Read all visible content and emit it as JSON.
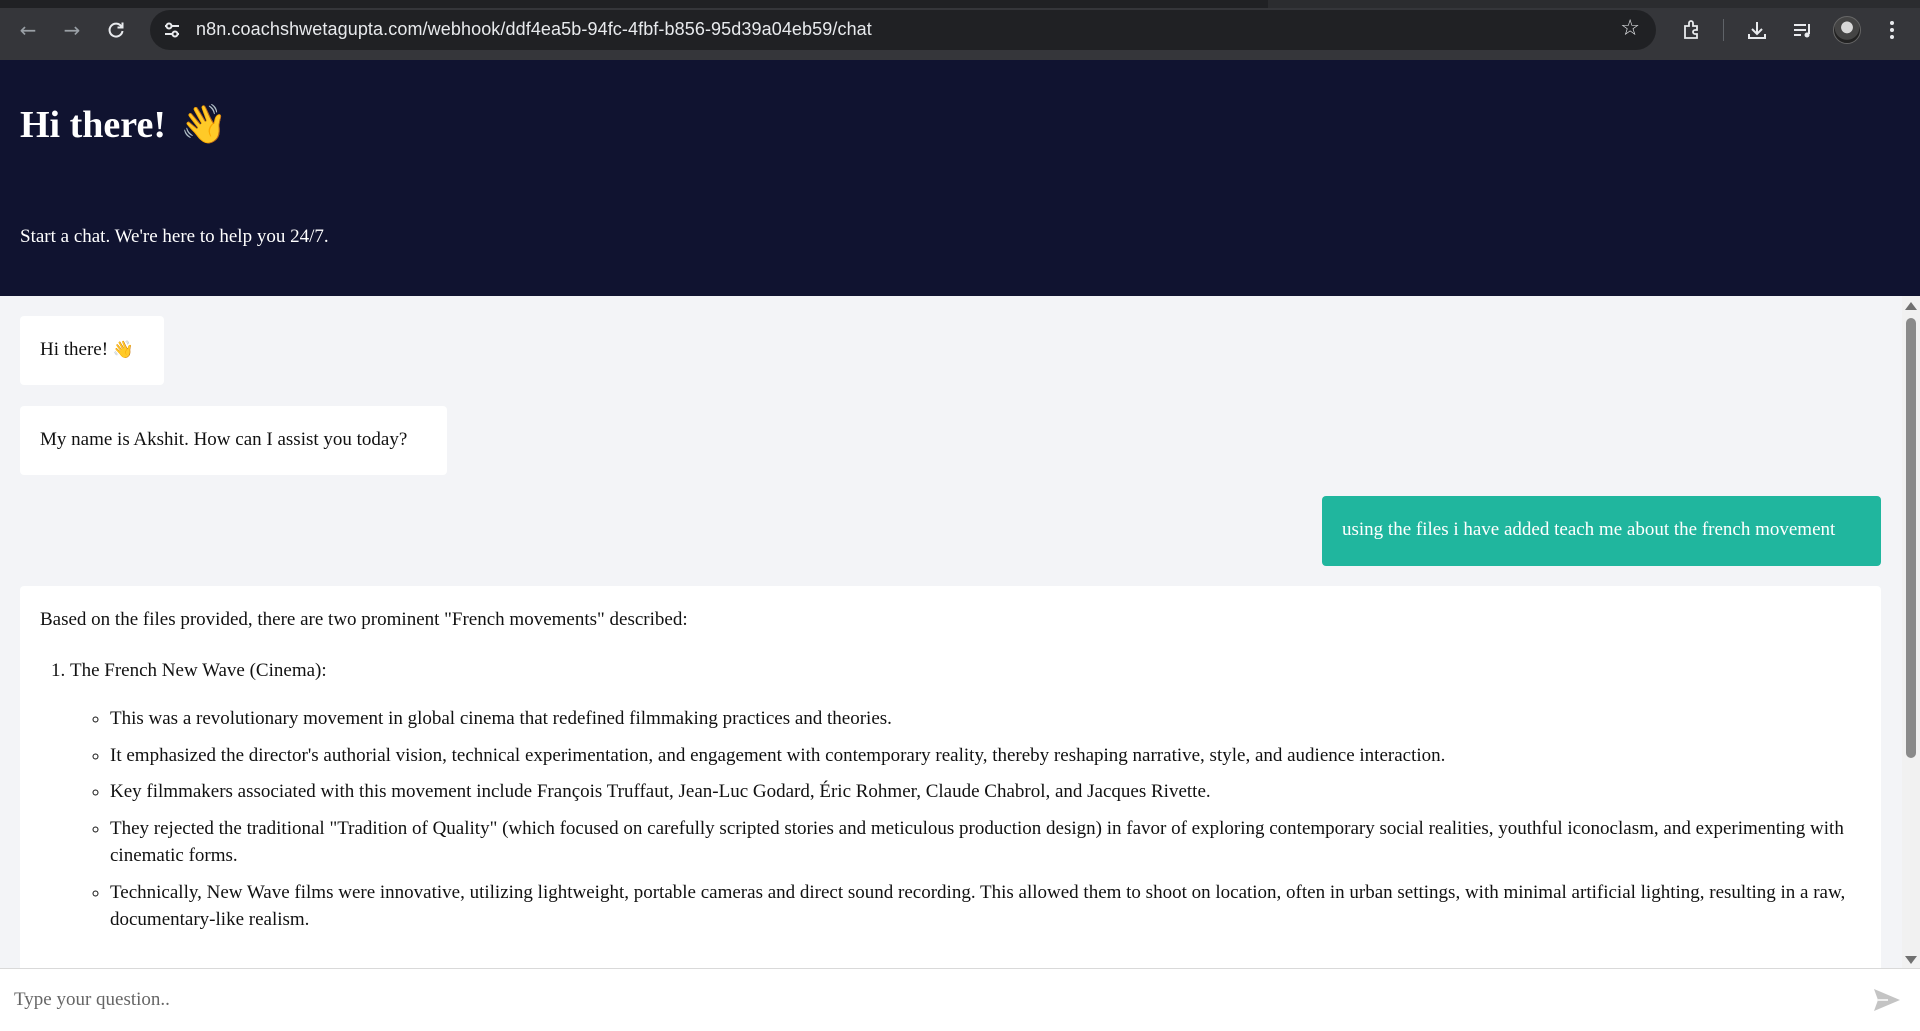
{
  "browser": {
    "url": "n8n.coachshwetagupta.com/webhook/ddf4ea5b-94fc-4fbf-b856-95d39a04eb59/chat",
    "back_icon": "←",
    "forward_icon": "→",
    "reload_icon": "⟳",
    "star_icon": "☆"
  },
  "header": {
    "title": "Hi there!",
    "wave_emoji": "👋",
    "subtitle": "Start a chat. We're here to help you 24/7."
  },
  "messages": [
    {
      "role": "bot",
      "text": "Hi there!",
      "emoji": "👋"
    },
    {
      "role": "bot",
      "text": "My name is Akshit. How can I assist you today?"
    },
    {
      "role": "user",
      "text": "using the files i have added teach me about the french movement"
    },
    {
      "role": "bot",
      "intro": "Based on the files provided, there are two prominent \"French movements\" described:",
      "list_item_1": "The French New Wave (Cinema):",
      "bullets": [
        "This was a revolutionary movement in global cinema that redefined filmmaking practices and theories.",
        "It emphasized the director's authorial vision, technical experimentation, and engagement with contemporary reality, thereby reshaping narrative, style, and audience interaction.",
        "Key filmmakers associated with this movement include François Truffaut, Jean-Luc Godard, Éric Rohmer, Claude Chabrol, and Jacques Rivette.",
        "They rejected the traditional \"Tradition of Quality\" (which focused on carefully scripted stories and meticulous production design) in favor of exploring contemporary social realities, youthful iconoclasm, and experimenting with cinematic forms.",
        "Technically, New Wave films were innovative, utilizing lightweight, portable cameras and direct sound recording. This allowed them to shoot on location, often in urban settings, with minimal artificial lighting, resulting in a raw, documentary-like realism."
      ]
    }
  ],
  "input": {
    "placeholder": "Type your question.."
  },
  "colors": {
    "header_bg": "#101330",
    "user_bubble": "#20b69e",
    "page_bg": "#f3f4f7"
  }
}
